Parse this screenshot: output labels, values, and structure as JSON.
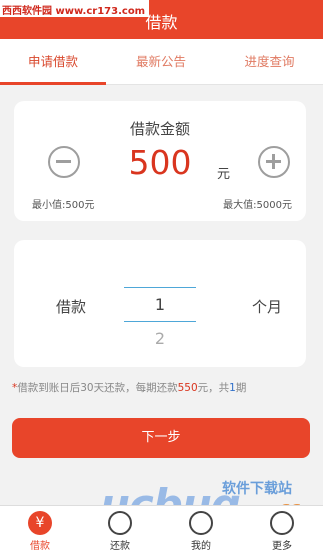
{
  "header": {
    "title": "借款",
    "watermark": "西西软件园 www.cr173.com"
  },
  "tabs": [
    {
      "label": "申请借款",
      "active": true
    },
    {
      "label": "最新公告",
      "active": false
    },
    {
      "label": "进度查询",
      "active": false
    }
  ],
  "amount": {
    "label": "借款金额",
    "value": "500",
    "unit": "元",
    "min_label": "最小值:500元",
    "max_label": "最大值:5000元"
  },
  "term": {
    "label": "借款",
    "selected": "1",
    "next": "2",
    "unit": "个月"
  },
  "note": {
    "star": "*",
    "text1": "借款到账日后30天还款，每期还款",
    "amount": "550",
    "text2": "元，共",
    "count": "1",
    "text3": "期"
  },
  "next_button": "下一步",
  "nav": [
    {
      "label": "借款",
      "icon": "yuan-icon",
      "symbol": "¥",
      "active": true
    },
    {
      "label": "还款",
      "icon": "repay-icon",
      "active": false
    },
    {
      "label": "我的",
      "icon": "user-icon",
      "active": false
    },
    {
      "label": "更多",
      "icon": "more-icon",
      "active": false
    }
  ],
  "watermark": {
    "brand": "ucbug",
    "site": "软件下载站",
    "domain": ".cc"
  },
  "colors": {
    "accent": "#e8452a",
    "value_red": "#d9351f",
    "picker_line": "#4ea7d8"
  }
}
